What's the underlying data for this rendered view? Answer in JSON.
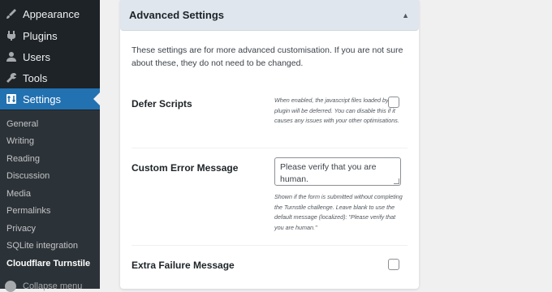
{
  "sidebar": {
    "menu": [
      {
        "label": "Appearance",
        "icon": "appearance-brush-icon"
      },
      {
        "label": "Plugins",
        "icon": "plugins-icon"
      },
      {
        "label": "Users",
        "icon": "users-icon"
      },
      {
        "label": "Tools",
        "icon": "tools-wrench-icon"
      },
      {
        "label": "Settings",
        "icon": "settings-sliders-icon",
        "active": true
      }
    ],
    "submenu": [
      "General",
      "Writing",
      "Reading",
      "Discussion",
      "Media",
      "Permalinks",
      "Privacy",
      "SQLite integration",
      "Cloudflare Turnstile"
    ],
    "current_submenu": "Cloudflare Turnstile",
    "collapse_label": "Collapse menu"
  },
  "panel": {
    "title": "Advanced Settings",
    "toggle_icon": "collapse-arrow-up-icon",
    "intro": "These settings are for more advanced customisation. If you are not sure about these, they do not need to be changed.",
    "defer_scripts": {
      "label": "Defer Scripts",
      "help": "When enabled, the javascript files loaded by the plugin will be deferred. You can disable this if it causes any issues with your other optimisations.",
      "checked": false
    },
    "custom_error": {
      "label": "Custom Error Message",
      "placeholder": "Please verify that you are human.",
      "help": "Shown if the form is submitted without completing the Turnstile challenge. Leave blank to use the default message (localized): \"Please verify that you are human.\""
    },
    "extra_failure": {
      "label": "Extra Failure Message",
      "checked": false
    }
  },
  "colors": {
    "sidebar_bg": "#1d2327",
    "submenu_bg": "#2c3338",
    "active_accent": "#2271b1",
    "panel_header_bg": "#dfe6ee",
    "page_bg": "#f0f0f1"
  }
}
